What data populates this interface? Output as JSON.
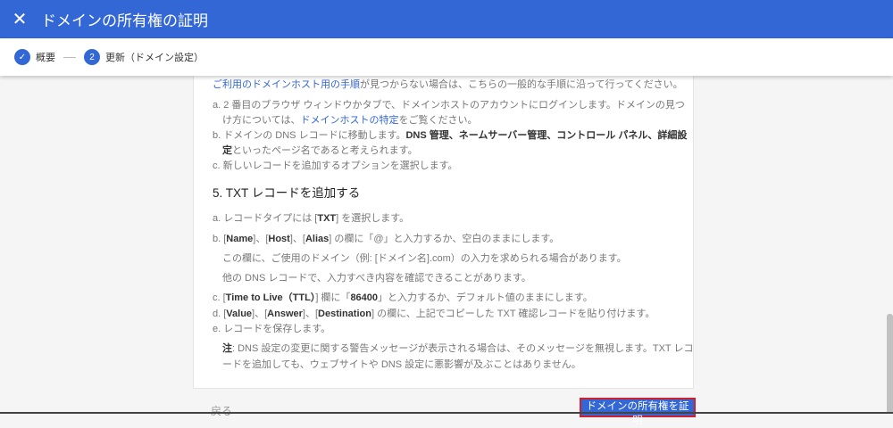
{
  "header": {
    "title": "ドメインの所有権の証明"
  },
  "stepper": {
    "step1": "概要",
    "step2_num": "2",
    "step2": "更新（ドメイン設定）"
  },
  "intro": {
    "link": "ご利用のドメインホスト用の手順",
    "text": "が見つからない場合は、こちらの一般的な手順に沿って行ってください。"
  },
  "steps4": {
    "a1": "a. 2 番目のブラウザ ウィンドウかタブで、ドメインホストのアカウントにログインします。ドメインの見つ",
    "a2": "け方については、",
    "a2_link": "ドメインホストの特定",
    "a2_end": "をご覧ください。",
    "b1": "b. ドメインの DNS レコードに移動します。",
    "b1_bold": "DNS 管理、ネームサーバー管理、コントロール パネル、詳細設",
    "b2_bold": "定",
    "b2": "といったページ名であると考えられます。",
    "c": "c. 新しいレコードを追加するオプションを選択します。"
  },
  "section5": {
    "heading": "5. TXT レコードを追加する",
    "a_pre": "a. レコードタイプには [",
    "a_bold": "TXT",
    "a_post": "] を選択します。",
    "b_pre": "b. [",
    "b_name": "Name",
    "b_sep1": "]、[",
    "b_host": "Host",
    "b_sep2": "]、[",
    "b_alias": "Alias",
    "b_post": "] の欄に「@」と入力するか、空白のままにします。",
    "b_note1": "この欄に、ご使用のドメイン（例: [ドメイン名].com）の入力を求められる場合があります。",
    "b_note2": "他の DNS レコードで、入力すべき内容を確認できることがあります。",
    "c_pre": "c. [",
    "c_bold": "Time to Live（TTL）",
    "c_mid": "] 欄に「",
    "c_val": "86400",
    "c_post": "」と入力するか、デフォルト値のままにします。",
    "d_pre": "d. [",
    "d_value": "Value",
    "d_s1": "]、[",
    "d_answer": "Answer",
    "d_s2": "]、[",
    "d_dest": "Destination",
    "d_post": "] の欄に、上記でコピーした TXT 確認レコードを貼り付けます。",
    "e": "e. レコードを保存します。",
    "note_label": "注",
    "note1": ": DNS 設定の変更に関する警告メッセージが表示される場合は、そのメッセージを無視します。TXT レコ",
    "note2": "ードを追加しても、ウェブサイトや DNS 設定に悪影響が及ぶことはありません。"
  },
  "footer": {
    "back": "戻る",
    "verify": "ドメインの所有権を証明"
  }
}
